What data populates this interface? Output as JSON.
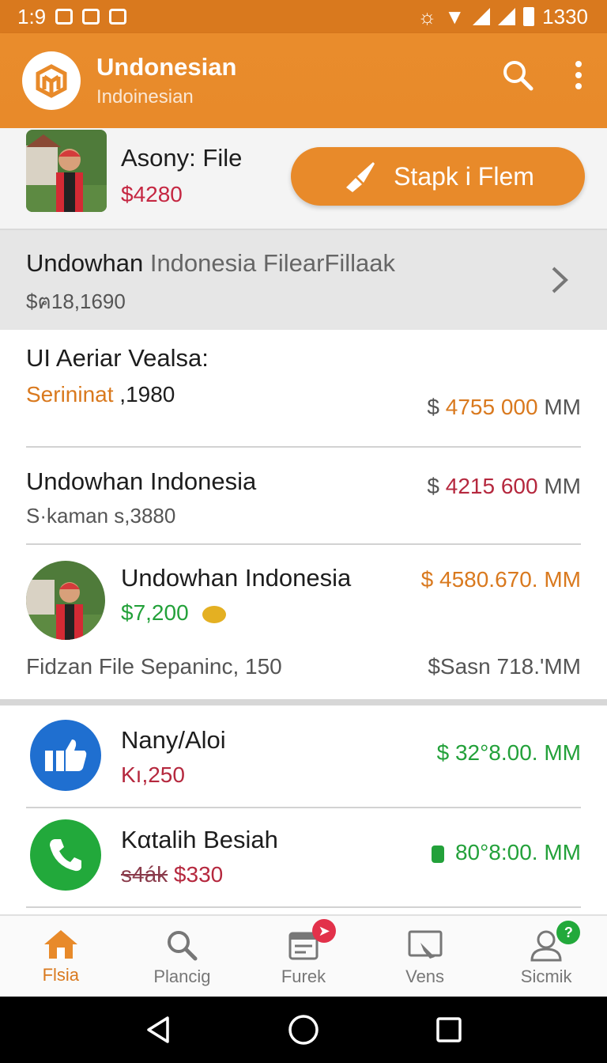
{
  "status_bar": {
    "time": "1:9",
    "battery": "1330"
  },
  "app_bar": {
    "title": "Undonesian",
    "subtitle": "Indoinesian"
  },
  "profile": {
    "name": "Asony: File",
    "price": "$4280",
    "cta_label": "Stapk i Flem"
  },
  "banner": {
    "title_bold": "Undowhan",
    "title_light": " Indonesia  FilearFillaak",
    "subtitle": "$ฅ18,1690"
  },
  "rows": [
    {
      "title": "UI Aeriar Vealsa:",
      "sub_a": "Serininat",
      "sub_b": " ,1980",
      "amount_prefix": "$ ",
      "amount_value": "4755 000",
      "amount_suffix": " MM"
    },
    {
      "title": "Undowhan Indonesia",
      "sub": "S·kaman s,3880",
      "amount_prefix": "$ ",
      "amount_value": "4215 600",
      "amount_suffix": " MM"
    },
    {
      "title": "Undowhan Indonesia",
      "sub": "$7,200",
      "amount": "$ 4580.670. MM",
      "footer_left": "Fidzan File Sepaninc, 150",
      "footer_right": "$Sasn 718.'MM"
    }
  ],
  "contacts": [
    {
      "title": "Nany/Aloi",
      "sub": "Kı,250",
      "amount": "$  32°8.00. MM",
      "icon": "thumbs-up-icon",
      "color": "#1f6fd0"
    },
    {
      "title": "Kαtalih Besiah",
      "sub_strike": "s4ák",
      "sub_rest": " $330",
      "amount": "80°8:00. MM",
      "icon": "phone-icon",
      "color": "#22a93b"
    }
  ],
  "bottom_nav": [
    {
      "label": "Flsia",
      "icon": "home-icon",
      "active": true
    },
    {
      "label": "Plancig",
      "icon": "search-icon"
    },
    {
      "label": "Furek",
      "icon": "calendar-icon"
    },
    {
      "label": "Vens",
      "icon": "folder-icon"
    },
    {
      "label": "Sicmik",
      "icon": "user-icon",
      "badge": "?"
    }
  ],
  "colors": {
    "brand": "#e88a2a",
    "status": "#d9791e",
    "red": "#c52742",
    "green": "#23a13a",
    "blue": "#1f6fd0"
  }
}
